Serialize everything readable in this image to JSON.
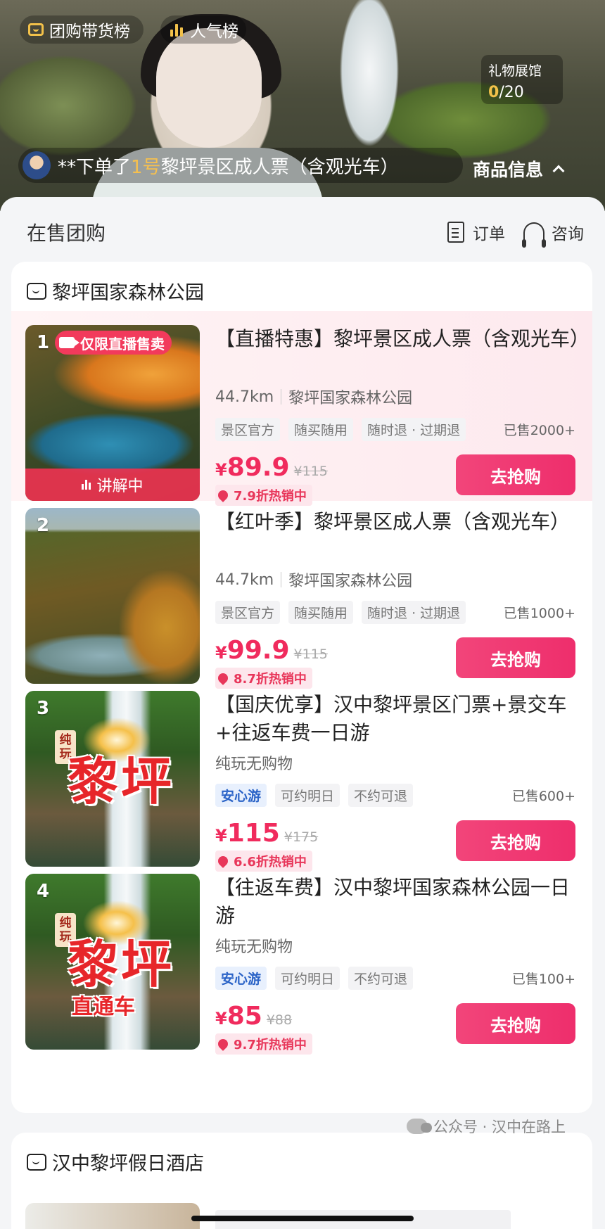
{
  "live": {
    "group_rank_label": "团购带货榜",
    "popularity_label": "人气榜",
    "gift_hall": {
      "title": "礼物展馆",
      "current": "0",
      "total": "/20"
    },
    "order_banner": {
      "prefix": "**下单了",
      "number": "1号",
      "suffix": "黎坪景区成人票（含观光车）"
    },
    "goods_info_label": "商品信息"
  },
  "sheet": {
    "title": "在售团购",
    "orders_label": "订单",
    "consult_label": "咨询"
  },
  "store1": {
    "name": "黎坪国家森林公园",
    "items": [
      {
        "rank": "1",
        "badge": "仅限直播售卖",
        "explaining": "讲解中",
        "title": "【直播特惠】黎坪景区成人票（含观光车）",
        "distance": "44.7km",
        "location": "黎坪国家森林公园",
        "tags": [
          "景区官方",
          "随买随用",
          "随时退 · 过期退"
        ],
        "sold": "已售2000+",
        "currency": "¥",
        "price": "89.9",
        "original": "¥115",
        "discount": "7.9折热销中",
        "buy_label": "去抢购"
      },
      {
        "rank": "2",
        "title": "【红叶季】黎坪景区成人票（含观光车）",
        "distance": "44.7km",
        "location": "黎坪国家森林公园",
        "tags": [
          "景区官方",
          "随买随用",
          "随时退 · 过期退"
        ],
        "sold": "已售1000+",
        "currency": "¥",
        "price": "99.9",
        "original": "¥115",
        "discount": "8.7折热销中",
        "buy_label": "去抢购"
      },
      {
        "rank": "3",
        "thumb_tag": "纯玩",
        "thumb_title": "黎坪",
        "title": "【国庆优享】汉中黎坪景区门票+景交车+往返车费一日游",
        "subtitle": "纯玩无购物",
        "tags": [
          "安心游",
          "可约明日",
          "不约可退"
        ],
        "sold": "已售600+",
        "currency": "¥",
        "price": "115",
        "original": "¥175",
        "discount": "6.6折热销中",
        "buy_label": "去抢购"
      },
      {
        "rank": "4",
        "thumb_tag": "纯玩",
        "thumb_title": "黎坪",
        "thumb_subtitle": "直通车",
        "title": "【往返车费】汉中黎坪国家森林公园一日游",
        "subtitle": "纯玩无购物",
        "tags": [
          "安心游",
          "可约明日",
          "不约可退"
        ],
        "sold": "已售100+",
        "currency": "¥",
        "price": "85",
        "original": "¥88",
        "discount": "9.7折热销中",
        "buy_label": "去抢购"
      }
    ]
  },
  "store2": {
    "name": "汉中黎坪假日酒店"
  },
  "watermark": "公众号 · 汉中在路上",
  "colors": {
    "accent": "#f02b5d",
    "buy_button": "#ee2e6c",
    "highlight": "#f6c04f"
  }
}
